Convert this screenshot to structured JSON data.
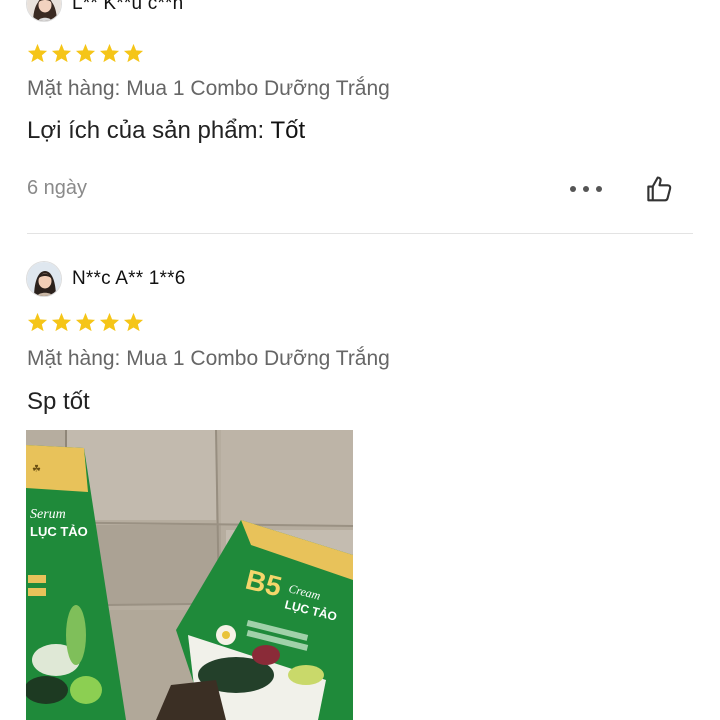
{
  "reviews": [
    {
      "username": "L** K**u c**h",
      "rating": 5,
      "variation": "Mặt hàng: Mua 1 Combo Dưỡng Trắng",
      "comment_label": "Lợi ích của sản phẩm: ",
      "comment_value": "Tốt",
      "time": "6 ngày",
      "more_icon": "more-horizontal-icon",
      "like_icon": "thumbs-up-icon"
    },
    {
      "username": "N**c A** 1**6",
      "rating": 5,
      "variation": "Mặt hàng: Mua 1 Combo Dưỡng Trắng",
      "comment": "Sp tốt",
      "photo_text": {
        "box1_line1": "Serum",
        "box1_line2": "LỤC TẢO",
        "box2_title": "B5",
        "box2_line1": "Cream",
        "box2_line2": "LỤC TẢO"
      }
    }
  ],
  "colors": {
    "star": "#f5c518",
    "box_green": "#1f8a3a",
    "box_gold": "#e8c25a",
    "cardboard": "#b6ad9f"
  }
}
